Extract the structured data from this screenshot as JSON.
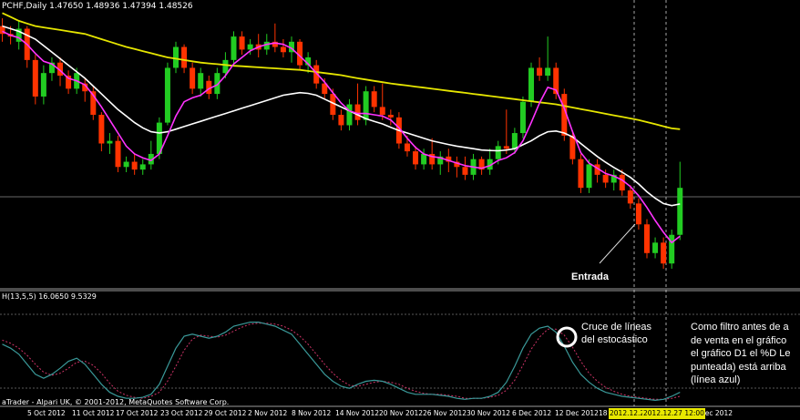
{
  "window": {
    "header": "PCHF,Daily  1.47650 1.48936 1.47394 1.48526",
    "indicator_header": "H(13,5,5) 16.0650 9.5329",
    "copyright": "aTrader - Alpari UK, © 2001-2012, MetaQuotes Software Corp."
  },
  "annotations": {
    "entrada": "Entrada",
    "cruce_lines": [
      "Cruce de líneas",
      "del estocástico"
    ],
    "filtro_lines": [
      "Como filtro antes de a",
      "de venta en el gráfico",
      "el gráfico D1  el %D Le",
      "punteada) está arriba",
      "(línea azul)"
    ]
  },
  "x_axis": {
    "labels": [
      "5 Oct 2012",
      "11 Oct 2012",
      "17 Oct 2012",
      "23 Oct 2012",
      "29 Oct 2012",
      "2 Nov 2012",
      "8 Nov 2012",
      "14 Nov 2012",
      "20 Nov 2012",
      "26 Nov 2012",
      "30 Nov 2012",
      "6 Dec 2012",
      "12 Dec 2012",
      "18",
      "Dec 2012"
    ],
    "highlight_labels": [
      "2012.12.21",
      "2012.12.27 12:00"
    ]
  },
  "colors": {
    "background": "#000000",
    "bull_candle": "#22cc22",
    "bear_candle": "#ff3300",
    "ma_slow": "#e6e600",
    "ma_mid": "#ffffff",
    "ma_fast": "#ff33ff",
    "stoch_main": "#3a9999",
    "stoch_signal": "#cc3366"
  },
  "chart_data": {
    "type": "candlestick",
    "candles": [
      {
        "o": 1.5,
        "c": 1.497,
        "h": 1.503,
        "l": 1.494
      },
      {
        "o": 1.497,
        "c": 1.496,
        "h": 1.5,
        "l": 1.493
      },
      {
        "o": 1.494,
        "c": 1.499,
        "h": 1.502,
        "l": 1.491
      },
      {
        "o": 1.499,
        "c": 1.487,
        "h": 1.5,
        "l": 1.484
      },
      {
        "o": 1.487,
        "c": 1.473,
        "h": 1.489,
        "l": 1.47
      },
      {
        "o": 1.473,
        "c": 1.482,
        "h": 1.485,
        "l": 1.47
      },
      {
        "o": 1.482,
        "c": 1.486,
        "h": 1.488,
        "l": 1.479
      },
      {
        "o": 1.486,
        "c": 1.481,
        "h": 1.488,
        "l": 1.477
      },
      {
        "o": 1.481,
        "c": 1.476,
        "h": 1.483,
        "l": 1.474
      },
      {
        "o": 1.476,
        "c": 1.482,
        "h": 1.484,
        "l": 1.474
      },
      {
        "o": 1.478,
        "c": 1.475,
        "h": 1.48,
        "l": 1.471
      },
      {
        "o": 1.475,
        "c": 1.466,
        "h": 1.477,
        "l": 1.464
      },
      {
        "o": 1.466,
        "c": 1.455,
        "h": 1.467,
        "l": 1.452
      },
      {
        "o": 1.455,
        "c": 1.456,
        "h": 1.459,
        "l": 1.451
      },
      {
        "o": 1.456,
        "c": 1.446,
        "h": 1.458,
        "l": 1.444
      },
      {
        "o": 1.446,
        "c": 1.448,
        "h": 1.45,
        "l": 1.444
      },
      {
        "o": 1.448,
        "c": 1.445,
        "h": 1.451,
        "l": 1.443
      },
      {
        "o": 1.445,
        "c": 1.447,
        "h": 1.449,
        "l": 1.443
      },
      {
        "o": 1.447,
        "c": 1.451,
        "h": 1.456,
        "l": 1.445
      },
      {
        "o": 1.451,
        "c": 1.463,
        "h": 1.465,
        "l": 1.449
      },
      {
        "o": 1.463,
        "c": 1.484,
        "h": 1.486,
        "l": 1.462
      },
      {
        "o": 1.484,
        "c": 1.492,
        "h": 1.494,
        "l": 1.482
      },
      {
        "o": 1.492,
        "c": 1.484,
        "h": 1.493,
        "l": 1.482
      },
      {
        "o": 1.484,
        "c": 1.476,
        "h": 1.486,
        "l": 1.474
      },
      {
        "o": 1.476,
        "c": 1.482,
        "h": 1.484,
        "l": 1.473
      },
      {
        "o": 1.479,
        "c": 1.474,
        "h": 1.481,
        "l": 1.472
      },
      {
        "o": 1.474,
        "c": 1.482,
        "h": 1.484,
        "l": 1.472
      },
      {
        "o": 1.482,
        "c": 1.487,
        "h": 1.49,
        "l": 1.48
      },
      {
        "o": 1.487,
        "c": 1.496,
        "h": 1.498,
        "l": 1.485
      },
      {
        "o": 1.496,
        "c": 1.491,
        "h": 1.498,
        "l": 1.489
      },
      {
        "o": 1.491,
        "c": 1.493,
        "h": 1.495,
        "l": 1.489
      },
      {
        "o": 1.493,
        "c": 1.491,
        "h": 1.497,
        "l": 1.488
      },
      {
        "o": 1.491,
        "c": 1.494,
        "h": 1.497,
        "l": 1.489
      },
      {
        "o": 1.494,
        "c": 1.492,
        "h": 1.501,
        "l": 1.49
      },
      {
        "o": 1.492,
        "c": 1.49,
        "h": 1.495,
        "l": 1.488
      },
      {
        "o": 1.49,
        "c": 1.494,
        "h": 1.496,
        "l": 1.486
      },
      {
        "o": 1.494,
        "c": 1.485,
        "h": 1.495,
        "l": 1.483
      },
      {
        "o": 1.485,
        "c": 1.488,
        "h": 1.49,
        "l": 1.482
      },
      {
        "o": 1.485,
        "c": 1.478,
        "h": 1.487,
        "l": 1.476
      },
      {
        "o": 1.478,
        "c": 1.474,
        "h": 1.48,
        "l": 1.472
      },
      {
        "o": 1.474,
        "c": 1.466,
        "h": 1.476,
        "l": 1.464
      },
      {
        "o": 1.466,
        "c": 1.462,
        "h": 1.468,
        "l": 1.46
      },
      {
        "o": 1.462,
        "c": 1.47,
        "h": 1.472,
        "l": 1.46
      },
      {
        "o": 1.47,
        "c": 1.464,
        "h": 1.478,
        "l": 1.462
      },
      {
        "o": 1.464,
        "c": 1.475,
        "h": 1.477,
        "l": 1.462
      },
      {
        "o": 1.475,
        "c": 1.469,
        "h": 1.477,
        "l": 1.467
      },
      {
        "o": 1.469,
        "c": 1.466,
        "h": 1.478,
        "l": 1.464
      },
      {
        "o": 1.466,
        "c": 1.465,
        "h": 1.468,
        "l": 1.462
      },
      {
        "o": 1.465,
        "c": 1.455,
        "h": 1.467,
        "l": 1.453
      },
      {
        "o": 1.455,
        "c": 1.452,
        "h": 1.458,
        "l": 1.45
      },
      {
        "o": 1.452,
        "c": 1.447,
        "h": 1.454,
        "l": 1.445
      },
      {
        "o": 1.447,
        "c": 1.451,
        "h": 1.453,
        "l": 1.445
      },
      {
        "o": 1.451,
        "c": 1.447,
        "h": 1.457,
        "l": 1.445
      },
      {
        "o": 1.447,
        "c": 1.45,
        "h": 1.452,
        "l": 1.443
      },
      {
        "o": 1.45,
        "c": 1.448,
        "h": 1.453,
        "l": 1.444
      },
      {
        "o": 1.448,
        "c": 1.446,
        "h": 1.45,
        "l": 1.442
      },
      {
        "o": 1.446,
        "c": 1.443,
        "h": 1.45,
        "l": 1.441
      },
      {
        "o": 1.443,
        "c": 1.449,
        "h": 1.451,
        "l": 1.441
      },
      {
        "o": 1.449,
        "c": 1.445,
        "h": 1.45,
        "l": 1.443
      },
      {
        "o": 1.445,
        "c": 1.449,
        "h": 1.453,
        "l": 1.443
      },
      {
        "o": 1.449,
        "c": 1.454,
        "h": 1.456,
        "l": 1.447
      },
      {
        "o": 1.454,
        "c": 1.453,
        "h": 1.468,
        "l": 1.451
      },
      {
        "o": 1.453,
        "c": 1.459,
        "h": 1.461,
        "l": 1.451
      },
      {
        "o": 1.459,
        "c": 1.471,
        "h": 1.473,
        "l": 1.457
      },
      {
        "o": 1.471,
        "c": 1.484,
        "h": 1.486,
        "l": 1.469
      },
      {
        "o": 1.484,
        "c": 1.481,
        "h": 1.488,
        "l": 1.479
      },
      {
        "o": 1.481,
        "c": 1.484,
        "h": 1.496,
        "l": 1.479
      },
      {
        "o": 1.484,
        "c": 1.474,
        "h": 1.486,
        "l": 1.472
      },
      {
        "o": 1.474,
        "c": 1.458,
        "h": 1.476,
        "l": 1.456
      },
      {
        "o": 1.458,
        "c": 1.449,
        "h": 1.46,
        "l": 1.447
      },
      {
        "o": 1.449,
        "c": 1.438,
        "h": 1.451,
        "l": 1.436
      },
      {
        "o": 1.438,
        "c": 1.447,
        "h": 1.449,
        "l": 1.436
      },
      {
        "o": 1.447,
        "c": 1.443,
        "h": 1.449,
        "l": 1.44
      },
      {
        "o": 1.443,
        "c": 1.44,
        "h": 1.445,
        "l": 1.438
      },
      {
        "o": 1.44,
        "c": 1.443,
        "h": 1.445,
        "l": 1.437
      },
      {
        "o": 1.443,
        "c": 1.437,
        "h": 1.445,
        "l": 1.435
      },
      {
        "o": 1.437,
        "c": 1.432,
        "h": 1.439,
        "l": 1.43
      },
      {
        "o": 1.432,
        "c": 1.424,
        "h": 1.434,
        "l": 1.422
      },
      {
        "o": 1.424,
        "c": 1.413,
        "h": 1.426,
        "l": 1.411
      },
      {
        "o": 1.413,
        "c": 1.417,
        "h": 1.419,
        "l": 1.411
      },
      {
        "o": 1.417,
        "c": 1.409,
        "h": 1.419,
        "l": 1.407
      },
      {
        "o": 1.409,
        "c": 1.42,
        "h": 1.422,
        "l": 1.407
      },
      {
        "o": 1.42,
        "c": 1.438,
        "h": 1.448,
        "l": 1.418
      }
    ],
    "ma_slow": [
      1.505,
      1.5035,
      1.502,
      1.501,
      1.5,
      1.4995,
      1.499,
      1.4985,
      1.498,
      1.4975,
      1.497,
      1.496,
      1.495,
      1.494,
      1.493,
      1.492,
      1.4912,
      1.4904,
      1.4896,
      1.4888,
      1.488,
      1.4875,
      1.487,
      1.4865,
      1.486,
      1.4857,
      1.4854,
      1.4851,
      1.4848,
      1.4846,
      1.4844,
      1.4842,
      1.484,
      1.4838,
      1.4836,
      1.4834,
      1.4832,
      1.4828,
      1.4824,
      1.482,
      1.4816,
      1.4812,
      1.4806,
      1.48,
      1.4795,
      1.479,
      1.4785,
      1.478,
      1.4776,
      1.4772,
      1.4768,
      1.4764,
      1.476,
      1.4756,
      1.4752,
      1.4748,
      1.4744,
      1.474,
      1.4736,
      1.4732,
      1.4728,
      1.4724,
      1.472,
      1.4716,
      1.4712,
      1.4708,
      1.4704,
      1.47,
      1.4694,
      1.4688,
      1.4682,
      1.4676,
      1.467,
      1.4664,
      1.4658,
      1.4652,
      1.4646,
      1.464,
      1.4632,
      1.4624,
      1.4616,
      1.4608,
      1.4605
    ],
    "ma_mid": [
      1.5,
      1.499,
      1.498,
      1.4965,
      1.495,
      1.4925,
      1.49,
      1.4875,
      1.485,
      1.4825,
      1.48,
      1.477,
      1.474,
      1.471,
      1.468,
      1.4655,
      1.463,
      1.461,
      1.4595,
      1.459,
      1.4595,
      1.4605,
      1.4615,
      1.4625,
      1.4635,
      1.4645,
      1.4655,
      1.4665,
      1.4675,
      1.4685,
      1.4695,
      1.4705,
      1.4715,
      1.4725,
      1.4735,
      1.474,
      1.4745,
      1.4742,
      1.4735,
      1.472,
      1.4705,
      1.469,
      1.4675,
      1.466,
      1.4645,
      1.4635,
      1.4625,
      1.4612,
      1.46,
      1.459,
      1.458,
      1.457,
      1.456,
      1.4553,
      1.4546,
      1.454,
      1.4535,
      1.453,
      1.4525,
      1.4523,
      1.4522,
      1.4525,
      1.453,
      1.4545,
      1.456,
      1.458,
      1.4595,
      1.4598,
      1.459,
      1.4575,
      1.455,
      1.4525,
      1.45,
      1.4478,
      1.4458,
      1.444,
      1.442,
      1.4395,
      1.4365,
      1.434,
      1.432,
      1.4312,
      1.4318
    ],
    "ma_fast": [
      1.498,
      1.4965,
      1.4955,
      1.493,
      1.4895,
      1.4865,
      1.4855,
      1.483,
      1.48,
      1.479,
      1.4775,
      1.4735,
      1.469,
      1.464,
      1.459,
      1.454,
      1.451,
      1.4495,
      1.4485,
      1.451,
      1.458,
      1.4655,
      1.471,
      1.4725,
      1.4735,
      1.476,
      1.4775,
      1.481,
      1.4855,
      1.488,
      1.4905,
      1.492,
      1.493,
      1.4935,
      1.493,
      1.4915,
      1.4885,
      1.4855,
      1.482,
      1.4785,
      1.4745,
      1.4705,
      1.4675,
      1.4665,
      1.4665,
      1.466,
      1.4655,
      1.464,
      1.461,
      1.457,
      1.4535,
      1.451,
      1.45,
      1.4495,
      1.4485,
      1.4475,
      1.4465,
      1.446,
      1.4455,
      1.4465,
      1.4485,
      1.4495,
      1.4515,
      1.456,
      1.463,
      1.4705,
      1.4765,
      1.4755,
      1.4685,
      1.4595,
      1.4515,
      1.4475,
      1.4455,
      1.4435,
      1.4425,
      1.441,
      1.4385,
      1.435,
      1.4305,
      1.4255,
      1.421,
      1.417,
      1.4195
    ],
    "stoch_main": [
      62,
      58,
      52,
      42,
      32,
      28,
      32,
      38,
      45,
      48,
      42,
      32,
      22,
      14,
      10,
      8,
      8,
      9,
      12,
      22,
      40,
      58,
      70,
      72,
      70,
      68,
      70,
      74,
      80,
      82,
      84,
      84,
      82,
      80,
      76,
      72,
      62,
      52,
      42,
      32,
      25,
      20,
      18,
      22,
      25,
      26,
      25,
      22,
      18,
      14,
      12,
      12,
      12,
      11,
      10,
      8,
      7,
      8,
      8,
      10,
      14,
      24,
      40,
      58,
      72,
      78,
      80,
      74,
      60,
      44,
      32,
      24,
      18,
      14,
      12,
      10,
      9,
      8,
      7,
      6,
      7,
      10,
      14
    ],
    "stoch_signal": [
      66,
      63,
      58,
      51,
      42,
      34,
      31,
      33,
      38,
      44,
      45,
      41,
      33,
      23,
      15,
      11,
      9,
      8,
      10,
      14,
      25,
      40,
      56,
      67,
      71,
      70,
      69,
      71,
      75,
      79,
      82,
      83,
      83,
      82,
      80,
      76,
      70,
      62,
      52,
      42,
      33,
      26,
      21,
      20,
      22,
      24,
      25,
      24,
      22,
      18,
      15,
      13,
      12,
      12,
      11,
      10,
      8,
      8,
      8,
      9,
      11,
      16,
      26,
      41,
      57,
      69,
      77,
      77,
      71,
      59,
      45,
      33,
      25,
      19,
      15,
      12,
      10,
      9,
      8,
      7,
      7,
      8,
      10
    ],
    "ylim": [
      1.4,
      1.51
    ],
    "stoch_ylim": [
      0,
      100
    ],
    "grid": false
  }
}
